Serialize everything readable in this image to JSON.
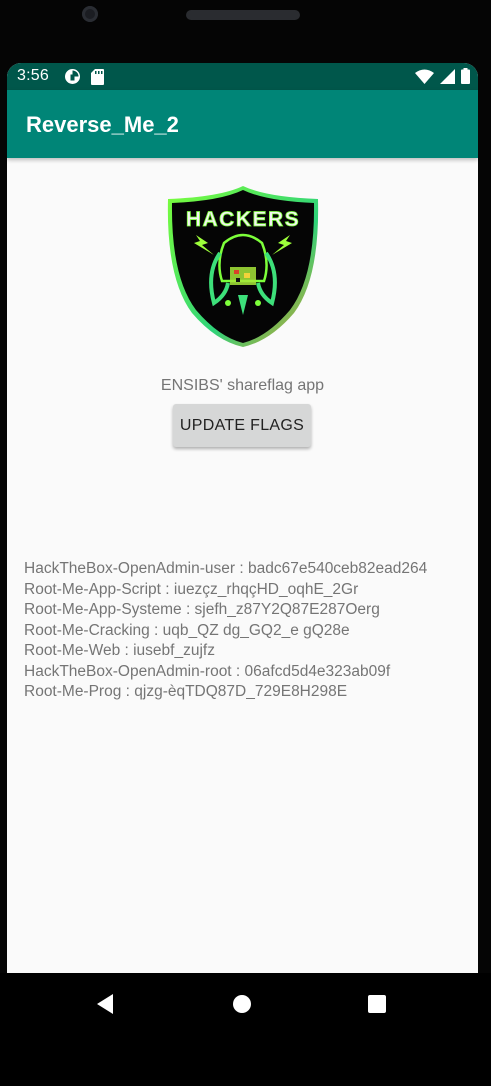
{
  "status_bar": {
    "time": "3:56",
    "left_icons": [
      "pie-notification-icon",
      "sd-card-icon"
    ],
    "right_icons": [
      "wifi-icon",
      "signal-icon",
      "battery-icon"
    ]
  },
  "app_bar": {
    "title": "Reverse_Me_2"
  },
  "logo": {
    "text": "HACKERS"
  },
  "main": {
    "subtitle": "ENSIBS' shareflag app",
    "update_button_label": "UPDATE FLAGS",
    "flags": [
      "HackTheBox-OpenAdmin-user : badc67e540ceb82ead264",
      "Root-Me-App-Script : iuezçz_rhqçHD_oqhE_2Gr",
      "Root-Me-App-Systeme : sjefh_z87Y2Q87E287Oerg",
      "Root-Me-Cracking : uqb_QZ dg_GQ2_e gQ28e",
      "Root-Me-Web : iusebf_zujfz",
      "HackTheBox-OpenAdmin-root : 06afcd5d4e323ab09f",
      "Root-Me-Prog : qjzg-èqTDQ87D_729E8H298E"
    ]
  },
  "nav_bar": {
    "buttons": [
      "back-icon",
      "home-icon",
      "recents-icon"
    ]
  },
  "colors": {
    "status_bar": "#00574b",
    "app_bar": "#008577",
    "background": "#fafafa",
    "button": "#d6d7d7",
    "text_secondary": "#757575"
  }
}
